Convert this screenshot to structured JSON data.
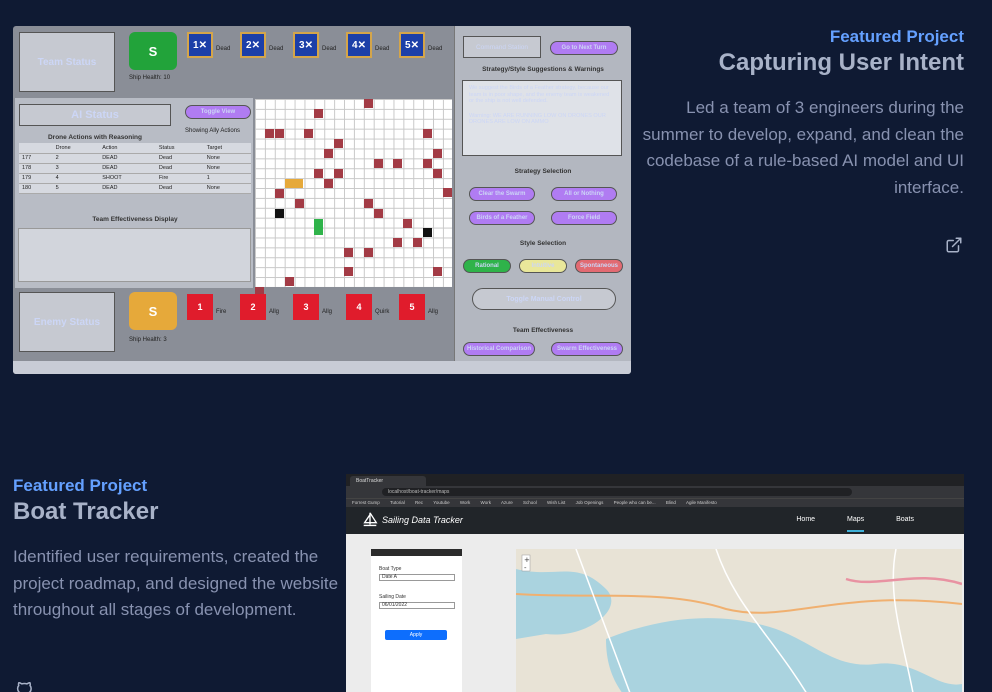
{
  "project1": {
    "overline": "Featured Project",
    "title": "Capturing User Intent",
    "description": "Led a team of 3 engineers during the summer to develop, expand, and clean the codebase of a rule-based AI model and UI interface.",
    "link_icon": "external-link-icon",
    "screenshot": {
      "team_status": "Team Status",
      "team_badge": "S",
      "ship_health_team": "Ship Health: 10",
      "team_drones": [
        {
          "label": "1",
          "status": "Dead"
        },
        {
          "label": "2",
          "status": "Dead"
        },
        {
          "label": "3",
          "status": "Dead"
        },
        {
          "label": "4",
          "status": "Dead"
        },
        {
          "label": "5",
          "status": "Dead"
        }
      ],
      "ai_status": "AI Status",
      "toggle_view": "Toggle View",
      "showing": "Showing Ally Actions",
      "drone_actions_title": "Drone Actions with Reasoning",
      "table_headers": [
        "",
        "Drone",
        "Action",
        "Status",
        "Target"
      ],
      "table_rows": [
        [
          "177",
          "2",
          "DEAD",
          "Dead",
          "None"
        ],
        [
          "178",
          "3",
          "DEAD",
          "Dead",
          "None"
        ],
        [
          "179",
          "4",
          "SHOOT",
          "Fire",
          "1"
        ],
        [
          "180",
          "5",
          "DEAD",
          "Dead",
          "None"
        ]
      ],
      "team_effectiveness_display": "Team Effectiveness Display",
      "enemy_status": "Enemy Status",
      "enemy_badge": "S",
      "ship_health_enemy": "Ship Health: 3",
      "enemy_drones": [
        {
          "label": "1",
          "status": "Fire"
        },
        {
          "label": "2",
          "status": "Allg"
        },
        {
          "label": "3",
          "status": "Allg"
        },
        {
          "label": "4",
          "status": "Quirk"
        },
        {
          "label": "5",
          "status": "Allg"
        }
      ],
      "command_station": "Command Station",
      "next_turn": "Go to Next Turn",
      "suggestions_title": "Strategy/Style Suggestions & Warnings",
      "suggestion_text": "We suggest the Birds of a Feather strategy, because our team is in poor shape, and the enemy team is weakened or the ship is not well defended.",
      "warning_text": "Warning: WE ARE RUNNING LOW ON DRONES OUR DRONES ARE LOW ON AMMO",
      "strategy_title": "Strategy Selection",
      "strategies": [
        "Clear the Swarm",
        "All or Nothing",
        "Birds of a Feather",
        "Force Field"
      ],
      "style_title": "Style Selection",
      "styles": [
        "Rational",
        "Intuitive",
        "Spontaneous"
      ],
      "toggle_manual": "Toggle Manual Control",
      "team_eff_title": "Team Effectiveness",
      "team_eff_buttons": [
        "Historical Comparison",
        "Swarm Effectiveness"
      ],
      "colors": {
        "purple": "#b07cf2",
        "green": "#2fb34a",
        "yellow": "#e9e79a",
        "red": "#e26a72"
      }
    }
  },
  "project2": {
    "overline": "Featured Project",
    "title": "Boat Tracker",
    "description": "Identified user requirements, created the project roadmap, and designed the website throughout all stages of development.",
    "link_icon": "github-icon",
    "screenshot": {
      "tab_title": "BoatTracker",
      "url": "localhost/boat-tracker/maps",
      "bookmarks": [
        "Forrest Gump",
        "Tutorial",
        "Rec",
        "Youtube",
        "Work",
        "Work",
        "Azure",
        "School",
        "Wish List",
        "Job Openings",
        "People who can be...",
        "Blind",
        "Agile Manifesto"
      ],
      "brand": "Sailing Data Tracker",
      "nav": [
        "Home",
        "Maps",
        "Boats"
      ],
      "form": {
        "boat_type_label": "Boat Type",
        "boat_type_value": "Date A",
        "date_label": "Sailing Date",
        "date_value": "06/01/2022",
        "apply": "Apply"
      }
    }
  }
}
